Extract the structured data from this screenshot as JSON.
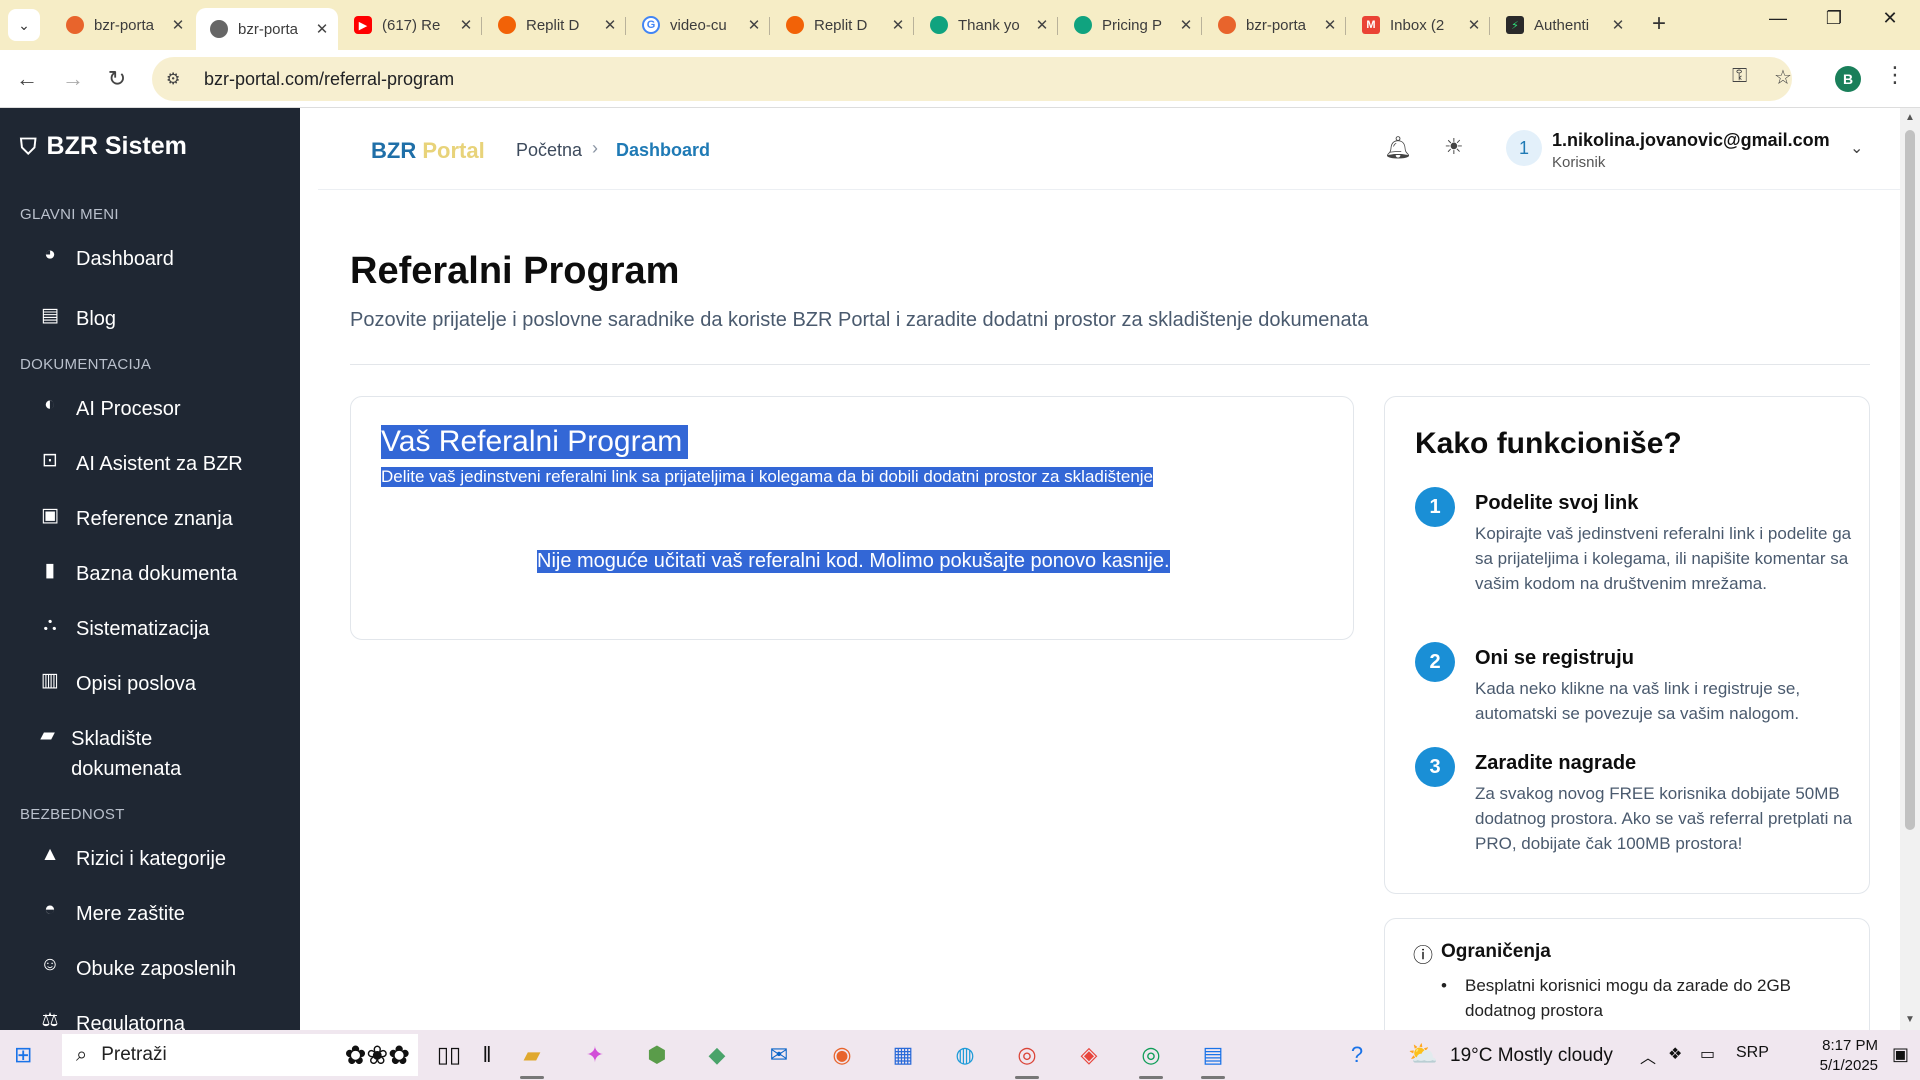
{
  "browser": {
    "tabs": [
      {
        "title": "bzr-porta",
        "icon": "bzr-favicon-icon",
        "color": "#e8642c"
      },
      {
        "title": "bzr-porta",
        "icon": "globe-icon",
        "color": "#555555",
        "active": true
      },
      {
        "title": "(617) Re",
        "icon": "youtube-icon",
        "color": "#ff0000"
      },
      {
        "title": "Replit D",
        "icon": "replit-icon",
        "color": "#f26207"
      },
      {
        "title": "video-cu",
        "icon": "google-icon",
        "color": "#4285f4"
      },
      {
        "title": "Replit D",
        "icon": "replit-icon",
        "color": "#f26207"
      },
      {
        "title": "Thank yo",
        "icon": "openai-icon",
        "color": "#10a37f"
      },
      {
        "title": "Pricing P",
        "icon": "openai-icon",
        "color": "#10a37f"
      },
      {
        "title": "bzr-porta",
        "icon": "bzr-favicon-icon",
        "color": "#e8642c"
      },
      {
        "title": "Inbox (2",
        "icon": "gmail-icon",
        "color": "#ea4335"
      },
      {
        "title": "Authenti",
        "icon": "auth-app-icon",
        "color": "#2a2a2a"
      }
    ],
    "url_host": "bzr-portal.com",
    "url_path": "/referral-program",
    "profile_initial": "B"
  },
  "sidebar": {
    "brand": "BZR Sistem",
    "sections": [
      {
        "label": "GLAVNI MENI",
        "items": [
          {
            "label": "Dashboard",
            "icon": "dashboard-icon"
          },
          {
            "label": "Blog",
            "icon": "newspaper-icon"
          }
        ]
      },
      {
        "label": "DOKUMENTACIJA",
        "items": [
          {
            "label": "AI Procesor",
            "icon": "brain-icon"
          },
          {
            "label": "AI Asistent za BZR",
            "icon": "robot-icon"
          },
          {
            "label": "Reference znanja",
            "icon": "book-icon"
          },
          {
            "label": "Bazna dokumenta",
            "icon": "file-icon"
          },
          {
            "label": "Sistematizacija",
            "icon": "org-chart-icon"
          },
          {
            "label": "Opisi poslova",
            "icon": "clipboard-icon"
          },
          {
            "label": "Skladište dokumenata",
            "icon": "folder-open-icon"
          }
        ]
      },
      {
        "label": "BEZBEDNOST",
        "items": [
          {
            "label": "Rizici i kategorije",
            "icon": "warning-icon"
          },
          {
            "label": "Mere zaštite",
            "icon": "hard-hat-icon"
          },
          {
            "label": "Obuke zaposlenih",
            "icon": "user-check-icon"
          },
          {
            "label": "Regulatorna",
            "icon": "scale-icon"
          }
        ]
      }
    ]
  },
  "header": {
    "logo_part1": "BZR",
    "logo_part2": "Portal",
    "breadcrumb_home": "Početna",
    "breadcrumb_current": "Dashboard",
    "user_avatar": "1",
    "user_email": "1.nikolina.jovanovic@gmail.com",
    "user_role": "Korisnik"
  },
  "page": {
    "title": "Referalni Program",
    "subtitle": "Pozovite prijatelje i poslovne saradnike da koriste BZR Portal i zaradite dodatni prostor za skladištenje dokumenata"
  },
  "referral_card": {
    "title": "Vaš Referalni Program",
    "description": "Delite vaš jedinstveni referalni link sa prijateljima i kolegama da bi dobili dodatni prostor za skladištenje",
    "error": "Nije moguće učitati vaš referalni kod. Molimo pokušajte ponovo kasnije."
  },
  "how_card": {
    "title": "Kako funkcioniše?",
    "steps": [
      {
        "num": "1",
        "title": "Podelite svoj link",
        "text": "Kopirajte vaš jedinstveni referalni link i podelite ga sa prijateljima i kolegama, ili napišite komentar sa vašim kodom na društvenim mrežama."
      },
      {
        "num": "2",
        "title": "Oni se registruju",
        "text": "Kada neko klikne na vaš link i registruje se, automatski se povezuje sa vašim nalogom."
      },
      {
        "num": "3",
        "title": "Zaradite nagrade",
        "text": "Za svakog novog FREE korisnika dobijate 50MB dodatnog prostora. Ako se vaš referral pretplati na PRO, dobijate čak 100MB prostora!"
      }
    ]
  },
  "limits_card": {
    "title": "Ograničenja",
    "items": [
      "Besplatni korisnici mogu da zarade do 2GB dodatnog prostora"
    ]
  },
  "taskbar": {
    "search_placeholder": "Pretraži",
    "weather": "19°C  Mostly cloudy",
    "language": "SRP",
    "time": "8:17 PM",
    "date": "5/1/2025"
  },
  "colors": {
    "sidebar_bg": "#1f2733",
    "accent": "#1a8fd6",
    "selection": "#3367d6",
    "tabbar_bg": "#f6edc6"
  }
}
